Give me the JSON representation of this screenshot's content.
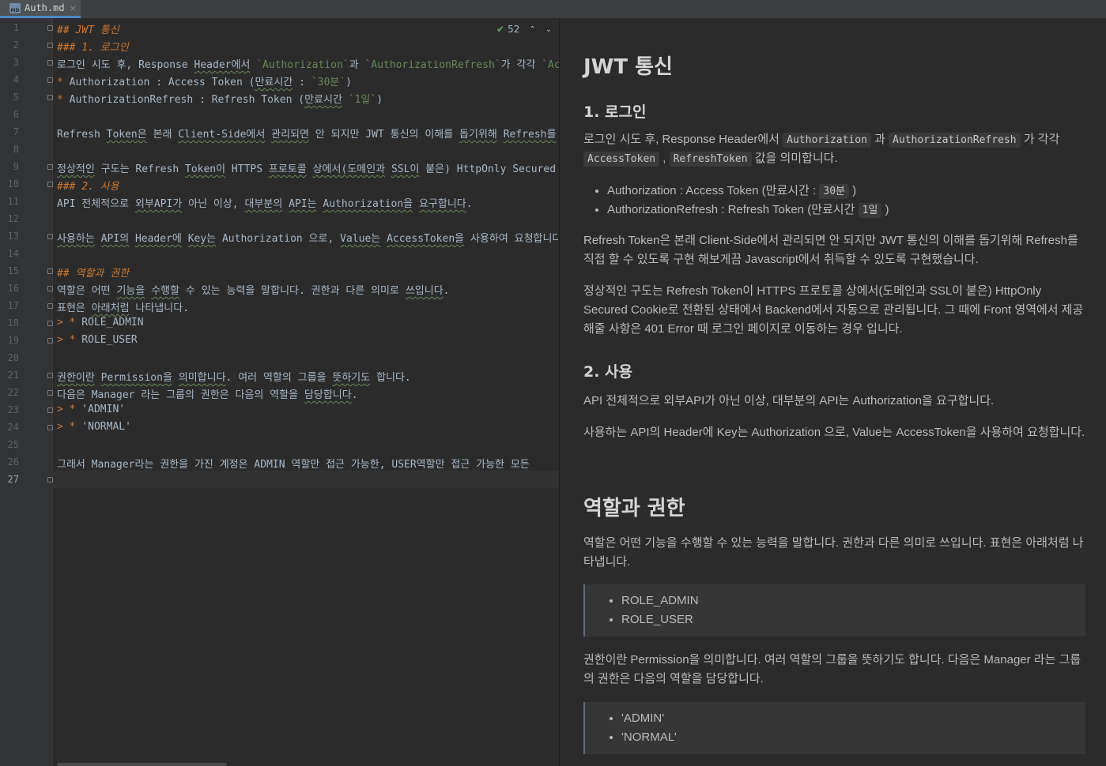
{
  "tab": {
    "icon": "md-file-icon",
    "icon_text": "MD",
    "label": "Auth.md",
    "close": "×"
  },
  "inspection": {
    "icon": "check-icon",
    "check": "✔",
    "count": "52",
    "up": "⌃",
    "down": "⌄"
  },
  "editor": {
    "line_numbers": [
      "1",
      "2",
      "3",
      "4",
      "5",
      "6",
      "7",
      "8",
      "9",
      "10",
      "11",
      "12",
      "13",
      "14",
      "15",
      "16",
      "17",
      "18",
      "19",
      "20",
      "21",
      "22",
      "23",
      "24",
      "25",
      "26",
      "27"
    ],
    "current_line": "27",
    "lines": [
      [
        {
          "t": "## JWT 통신",
          "s": "h"
        }
      ],
      [
        {
          "t": "### 1. 로그인",
          "s": "h"
        }
      ],
      [
        {
          "t": "로그인 시도 후, Response "
        },
        {
          "t": "Header에서",
          "s": "u"
        },
        {
          "t": " "
        },
        {
          "t": "`Authorization`",
          "s": "c"
        },
        {
          "t": "과 "
        },
        {
          "t": "`AuthorizationRefresh`",
          "s": "c"
        },
        {
          "t": "가 각각 "
        },
        {
          "t": "`AccessToken`",
          "s": "c"
        }
      ],
      [
        {
          "t": "*",
          "s": "b"
        },
        {
          "t": " Authorization : Access Token ("
        },
        {
          "t": "만료시간",
          "s": "u"
        },
        {
          "t": " : "
        },
        {
          "t": "`30분`",
          "s": "c"
        },
        {
          "t": ")"
        }
      ],
      [
        {
          "t": "*",
          "s": "b"
        },
        {
          "t": " AuthorizationRefresh : Refresh Token ("
        },
        {
          "t": "만료시간",
          "s": "u"
        },
        {
          "t": " "
        },
        {
          "t": "`1일`",
          "s": "c"
        },
        {
          "t": ")"
        }
      ],
      [],
      [
        {
          "t": "Refresh "
        },
        {
          "t": "Token은",
          "s": "u"
        },
        {
          "t": " 본래 "
        },
        {
          "t": "Client-Side에서",
          "s": "u"
        },
        {
          "t": " "
        },
        {
          "t": "관리되면",
          "s": "u"
        },
        {
          "t": " 안 되지만 JWT 통신의 이해를 "
        },
        {
          "t": "돕기위해",
          "s": "u"
        },
        {
          "t": " "
        },
        {
          "t": "Refresh를",
          "s": "u"
        },
        {
          "t": " 직접 할 수 있도록"
        }
      ],
      [],
      [
        {
          "t": "정상적인",
          "s": "u"
        },
        {
          "t": " 구도는 Refresh "
        },
        {
          "t": "Token이",
          "s": "u"
        },
        {
          "t": " HTTPS "
        },
        {
          "t": "프로토콜",
          "s": "u"
        },
        {
          "t": " "
        },
        {
          "t": "상에서(도메인과",
          "s": "u"
        },
        {
          "t": " "
        },
        {
          "t": "SSL이",
          "s": "u"
        },
        {
          "t": " 붙은) HttpOnly Secured Cookie로 전환된"
        }
      ],
      [
        {
          "t": "### 2. 사용",
          "s": "h"
        }
      ],
      [
        {
          "t": "API 전체적으로 "
        },
        {
          "t": "외부API가",
          "s": "u"
        },
        {
          "t": " 아닌 이상, "
        },
        {
          "t": "대부분의",
          "s": "u"
        },
        {
          "t": " "
        },
        {
          "t": "API는",
          "s": "u"
        },
        {
          "t": " "
        },
        {
          "t": "Authorization을",
          "s": "u"
        },
        {
          "t": " "
        },
        {
          "t": "요구합니다",
          "s": "u"
        },
        {
          "t": "."
        }
      ],
      [],
      [
        {
          "t": "사용하는",
          "s": "u"
        },
        {
          "t": " "
        },
        {
          "t": "API의",
          "s": "u"
        },
        {
          "t": " "
        },
        {
          "t": "Header에",
          "s": "u"
        },
        {
          "t": " "
        },
        {
          "t": "Key는",
          "s": "u"
        },
        {
          "t": " Authorization 으로, "
        },
        {
          "t": "Value는",
          "s": "u"
        },
        {
          "t": " "
        },
        {
          "t": "AccessToken을",
          "s": "u"
        },
        {
          "t": " 사용하여 요청합니다."
        }
      ],
      [],
      [
        {
          "t": "## 역할과 권한",
          "s": "h"
        }
      ],
      [
        {
          "t": "역할은 어떤 "
        },
        {
          "t": "기능을",
          "s": "u"
        },
        {
          "t": " "
        },
        {
          "t": "수행할",
          "s": "u"
        },
        {
          "t": " 수 있는 능력을 말합니다. 권한과 다른 의미로 "
        },
        {
          "t": "쓰입니다",
          "s": "u"
        },
        {
          "t": "."
        }
      ],
      [
        {
          "t": "표현은 "
        },
        {
          "t": "아래처럼",
          "s": "u"
        },
        {
          "t": " 나타냅니다."
        }
      ],
      [
        {
          "t": "> *",
          "s": "b"
        },
        {
          "t": " ROLE_ADMIN"
        }
      ],
      [
        {
          "t": "> *",
          "s": "b"
        },
        {
          "t": " ROLE_USER"
        }
      ],
      [],
      [
        {
          "t": "권한이란",
          "s": "u"
        },
        {
          "t": " "
        },
        {
          "t": "Permission을",
          "s": "u"
        },
        {
          "t": " "
        },
        {
          "t": "의미합니다",
          "s": "u"
        },
        {
          "t": ". 여러 역할의 그룹을 "
        },
        {
          "t": "뜻하기도",
          "s": "u"
        },
        {
          "t": " 합니다."
        }
      ],
      [
        {
          "t": "다음은 Manager 라는 그룹의 권한은 다음의 역할을 "
        },
        {
          "t": "담당합니다",
          "s": "u"
        },
        {
          "t": "."
        }
      ],
      [
        {
          "t": "> *",
          "s": "b"
        },
        {
          "t": " 'ADMIN'"
        }
      ],
      [
        {
          "t": "> *",
          "s": "b"
        },
        {
          "t": " 'NORMAL'"
        }
      ],
      [],
      [
        {
          "t": "그래서 "
        },
        {
          "t": "Manager라는",
          "s": "u"
        },
        {
          "t": " 권한을 가진 계정은 ADMIN 역할만 접근 가능한, "
        },
        {
          "t": "USER역할만",
          "s": "u"
        },
        {
          "t": " 접근 가능한 모든"
        }
      ],
      []
    ]
  },
  "preview": {
    "h1_jwt": "JWT 통신",
    "h2_login": "1. 로그인",
    "login_p": [
      {
        "t": "로그인 시도 후, Response Header에서 "
      },
      {
        "t": "Authorization",
        "code": true
      },
      {
        "t": " 과 "
      },
      {
        "t": "AuthorizationRefresh",
        "code": true
      },
      {
        "t": " 가 각각 "
      },
      {
        "t": "AccessToken",
        "code": true
      },
      {
        "t": " , "
      },
      {
        "t": "RefreshToken",
        "code": true
      },
      {
        "t": " 값을 의미합니다."
      }
    ],
    "login_list": [
      [
        {
          "t": "Authorization : Access Token (만료시간 : "
        },
        {
          "t": "30분",
          "code": true
        },
        {
          "t": " )"
        }
      ],
      [
        {
          "t": "AuthorizationRefresh : Refresh Token (만료시간 "
        },
        {
          "t": "1일",
          "code": true
        },
        {
          "t": " )"
        }
      ]
    ],
    "refresh_p": "Refresh Token은 본래 Client-Side에서 관리되면 안 되지만 JWT 통신의 이해를 돕기위해 Refresh를 직접 할 수 있도록 구현 해보게끔 Javascript에서 취득할 수 있도록 구현했습니다.",
    "secure_p": "정상적인 구도는 Refresh Token이 HTTPS 프로토콜 상에서(도메인과 SSL이 붙은) HttpOnly Secured Cookie로 전환된 상태에서 Backend에서 자동으로 관리됩니다. 그 때에 Front 영역에서 제공해줄 사항은 401 Error 때 로그인 페이지로 이동하는 경우 입니다.",
    "h2_use": "2. 사용",
    "use_p1": "API 전체적으로 외부API가 아닌 이상, 대부분의 API는 Authorization을 요구합니다.",
    "use_p2": "사용하는 API의 Header에 Key는 Authorization 으로, Value는 AccessToken을 사용하여 요청합니다.",
    "h1_role": "역할과 권한",
    "role_p": "역할은 어떤 기능을 수행할 수 있는 능력을 말합니다. 권한과 다른 의미로 쓰입니다. 표현은 아래처럼 나타냅니다.",
    "role_list": [
      "ROLE_ADMIN",
      "ROLE_USER"
    ],
    "perm_p": "권한이란 Permission을 의미합니다. 여러 역할의 그룹을 뜻하기도 합니다. 다음은 Manager 라는 그룹의 권한은 다음의 역할을 담당합니다.",
    "perm_list": [
      "'ADMIN'",
      "'NORMAL'"
    ]
  }
}
